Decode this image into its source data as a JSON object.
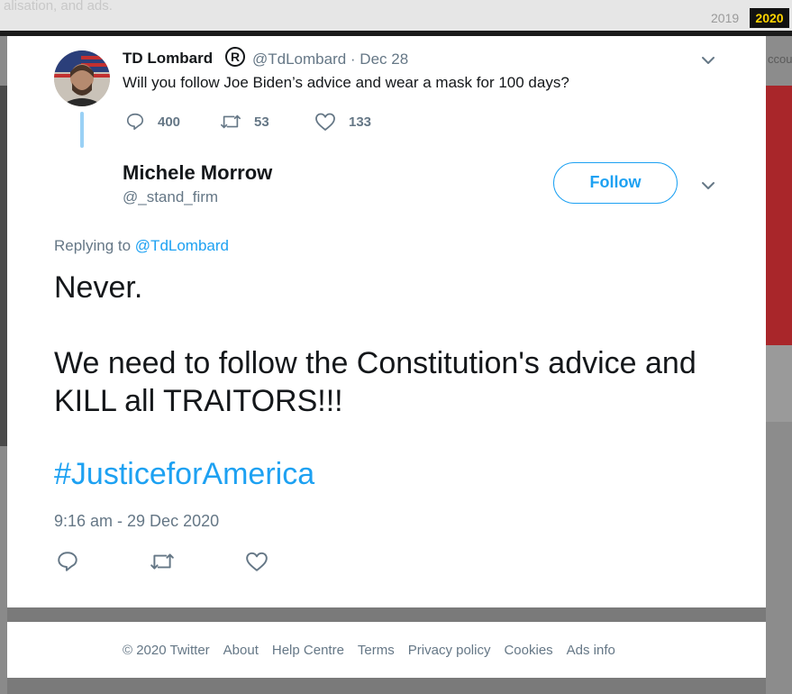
{
  "background": {
    "cookie_text": "alisation, and ads.",
    "year_prev": "2019",
    "year_current": "2020",
    "right_partial_text": "ccou"
  },
  "parent_tweet": {
    "name": "TD Lombard",
    "verified_mark": "R",
    "handle_date": "@TdLombard · Dec 28",
    "text": "Will you follow Joe Biden’s advice and wear a mask for 100 days?",
    "reply_count": "400",
    "retweet_count": "53",
    "like_count": "133"
  },
  "tweet": {
    "name": "Michele Morrow",
    "handle": "@_stand_firm",
    "follow_label": "Follow",
    "replying_prefix": "Replying to",
    "replying_mention": "@TdLombard",
    "line1": "Never.",
    "line2": "We need to follow the Constitution's advice and KILL all TRAITORS!!!",
    "hashtag": "#JusticeforAmerica",
    "timestamp": "9:16 am - 29 Dec 2020"
  },
  "footer": {
    "links": [
      "© 2020 Twitter",
      "About",
      "Help Centre",
      "Terms",
      "Privacy policy",
      "Cookies",
      "Ads info"
    ]
  },
  "colors": {
    "accent": "#1da1f2",
    "muted": "#657786",
    "text": "#14171a",
    "thread_line": "#9ad1f5"
  },
  "icons": [
    "reply-icon",
    "retweet-icon",
    "like-icon",
    "chevron-down-icon"
  ]
}
